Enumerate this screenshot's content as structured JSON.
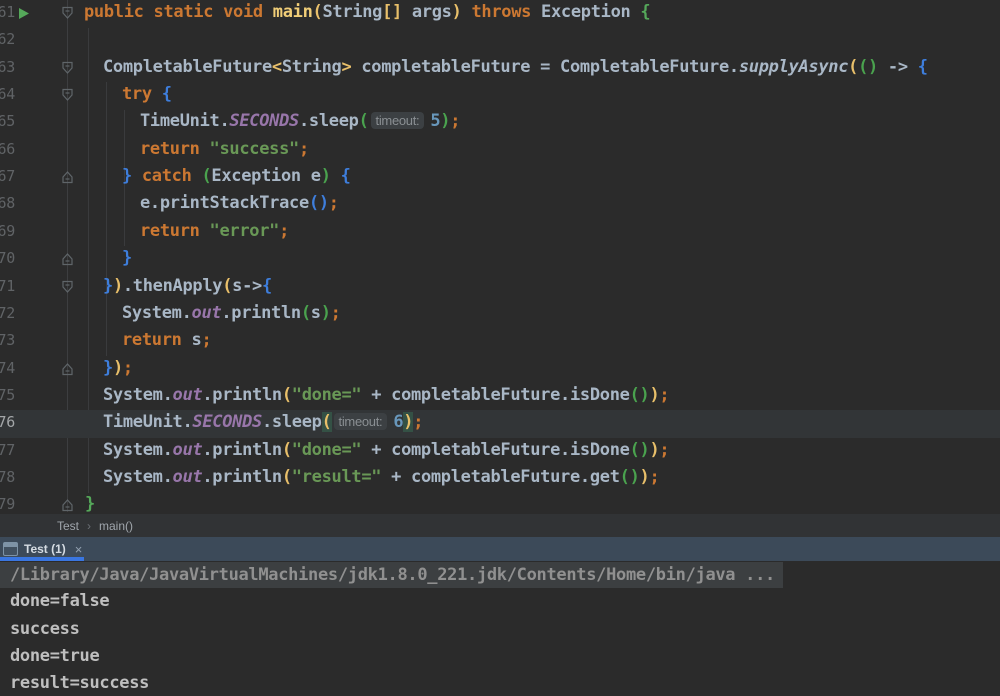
{
  "editor": {
    "lines": [
      {
        "num": "61",
        "indent": 84,
        "fold": "down",
        "run": true,
        "current": false,
        "tokens": [
          [
            "kw",
            "public static void "
          ],
          [
            "def",
            "main"
          ],
          [
            "y",
            "("
          ],
          [
            "txt",
            "String"
          ],
          [
            "y",
            "[]"
          ],
          [
            "txt",
            " args"
          ],
          [
            "y",
            ")"
          ],
          [
            "kw",
            " throws "
          ],
          [
            "txt",
            "Exception "
          ],
          [
            "mg",
            "{"
          ]
        ]
      },
      {
        "num": "62",
        "indent": 84,
        "fold": null,
        "run": false,
        "current": false,
        "tokens": []
      },
      {
        "num": "63",
        "indent": 103,
        "fold": "down",
        "run": false,
        "current": false,
        "tokens": [
          [
            "txt",
            "CompletableFuture"
          ],
          [
            "y",
            "<"
          ],
          [
            "txt",
            "String"
          ],
          [
            "y",
            ">"
          ],
          [
            "txt",
            " completableFuture = CompletableFuture."
          ],
          [
            "it",
            "supplyAsync"
          ],
          [
            "y",
            "("
          ],
          [
            "g",
            "()"
          ],
          [
            "txt",
            " -> "
          ],
          [
            "b",
            "{"
          ]
        ]
      },
      {
        "num": "64",
        "indent": 122,
        "fold": "down",
        "run": false,
        "current": false,
        "tokens": [
          [
            "kw",
            "try "
          ],
          [
            "b",
            "{"
          ]
        ]
      },
      {
        "num": "65",
        "indent": 140,
        "fold": null,
        "run": false,
        "current": false,
        "tokens": [
          [
            "txt",
            "TimeUnit."
          ],
          [
            "pu",
            "SECONDS"
          ],
          [
            "txt",
            ".sleep"
          ],
          [
            "g",
            "("
          ],
          [
            "hint",
            "timeout:"
          ],
          [
            "num",
            "5"
          ],
          [
            "g",
            ")"
          ],
          [
            "semi",
            ";"
          ]
        ]
      },
      {
        "num": "66",
        "indent": 140,
        "fold": null,
        "run": false,
        "current": false,
        "tokens": [
          [
            "kw",
            "return "
          ],
          [
            "str",
            "\"success\""
          ],
          [
            "semi",
            ";"
          ]
        ]
      },
      {
        "num": "67",
        "indent": 122,
        "fold": "up",
        "run": false,
        "current": false,
        "tokens": [
          [
            "b",
            "} "
          ],
          [
            "kw",
            "catch "
          ],
          [
            "g",
            "("
          ],
          [
            "txt",
            "Exception e"
          ],
          [
            "g",
            ")"
          ],
          [
            "txt",
            " "
          ],
          [
            "b",
            "{"
          ]
        ]
      },
      {
        "num": "68",
        "indent": 140,
        "fold": null,
        "run": false,
        "current": false,
        "tokens": [
          [
            "txt",
            "e.printStackTrace"
          ],
          [
            "b",
            "()"
          ],
          [
            "semi",
            ";"
          ]
        ]
      },
      {
        "num": "69",
        "indent": 140,
        "fold": null,
        "run": false,
        "current": false,
        "tokens": [
          [
            "kw",
            "return "
          ],
          [
            "str",
            "\"error\""
          ],
          [
            "semi",
            ";"
          ]
        ]
      },
      {
        "num": "70",
        "indent": 122,
        "fold": "up",
        "run": false,
        "current": false,
        "tokens": [
          [
            "b",
            "}"
          ]
        ]
      },
      {
        "num": "71",
        "indent": 103,
        "fold": "down",
        "run": false,
        "current": false,
        "tokens": [
          [
            "b",
            "}"
          ],
          [
            "y",
            ")"
          ],
          [
            "txt",
            ".thenApply"
          ],
          [
            "y",
            "("
          ],
          [
            "txt",
            "s->"
          ],
          [
            "b",
            "{"
          ]
        ]
      },
      {
        "num": "72",
        "indent": 122,
        "fold": null,
        "run": false,
        "current": false,
        "tokens": [
          [
            "txt",
            "System."
          ],
          [
            "pu",
            "out"
          ],
          [
            "txt",
            ".println"
          ],
          [
            "g",
            "("
          ],
          [
            "txt",
            "s"
          ],
          [
            "g",
            ")"
          ],
          [
            "semi",
            ";"
          ]
        ]
      },
      {
        "num": "73",
        "indent": 122,
        "fold": null,
        "run": false,
        "current": false,
        "tokens": [
          [
            "kw",
            "return "
          ],
          [
            "txt",
            "s"
          ],
          [
            "semi",
            ";"
          ]
        ]
      },
      {
        "num": "74",
        "indent": 103,
        "fold": "up",
        "run": false,
        "current": false,
        "tokens": [
          [
            "b",
            "}"
          ],
          [
            "y",
            ")"
          ],
          [
            "semi",
            ";"
          ]
        ]
      },
      {
        "num": "75",
        "indent": 103,
        "fold": null,
        "run": false,
        "current": false,
        "tokens": [
          [
            "txt",
            "System."
          ],
          [
            "pu",
            "out"
          ],
          [
            "txt",
            ".println"
          ],
          [
            "y",
            "("
          ],
          [
            "str",
            "\"done=\""
          ],
          [
            "txt",
            " + completableFuture.isDone"
          ],
          [
            "g",
            "()"
          ],
          [
            "y",
            ")"
          ],
          [
            "semi",
            ";"
          ]
        ]
      },
      {
        "num": "76",
        "indent": 103,
        "fold": null,
        "run": false,
        "current": true,
        "tokens": [
          [
            "txt",
            "TimeUnit."
          ],
          [
            "pu",
            "SECONDS"
          ],
          [
            "txt",
            ".sleep"
          ],
          [
            "yh",
            "("
          ],
          [
            "hint",
            "timeout:"
          ],
          [
            "num",
            "6"
          ],
          [
            "yh",
            ")"
          ],
          [
            "semi",
            ";"
          ]
        ]
      },
      {
        "num": "77",
        "indent": 103,
        "fold": null,
        "run": false,
        "current": false,
        "tokens": [
          [
            "txt",
            "System."
          ],
          [
            "pu",
            "out"
          ],
          [
            "txt",
            ".println"
          ],
          [
            "y",
            "("
          ],
          [
            "str",
            "\"done=\""
          ],
          [
            "txt",
            " + completableFuture.isDone"
          ],
          [
            "g",
            "()"
          ],
          [
            "y",
            ")"
          ],
          [
            "semi",
            ";"
          ]
        ]
      },
      {
        "num": "78",
        "indent": 103,
        "fold": null,
        "run": false,
        "current": false,
        "tokens": [
          [
            "txt",
            "System."
          ],
          [
            "pu",
            "out"
          ],
          [
            "txt",
            ".println"
          ],
          [
            "y",
            "("
          ],
          [
            "str",
            "\"result=\""
          ],
          [
            "txt",
            " + completableFuture.get"
          ],
          [
            "g",
            "()"
          ],
          [
            "y",
            ")"
          ],
          [
            "semi",
            ";"
          ]
        ]
      },
      {
        "num": "79",
        "indent": 85,
        "fold": "up",
        "run": false,
        "current": false,
        "tokens": [
          [
            "mg",
            "}"
          ]
        ]
      }
    ]
  },
  "breadcrumb": {
    "separator": "›",
    "items": [
      "Test",
      "main()"
    ]
  },
  "toolwindow": {
    "tab_label": "Test (1)",
    "close_label": "×"
  },
  "console": {
    "lines": [
      {
        "style": "path",
        "text": "/Library/Java/JavaVirtualMachines/jdk1.8.0_221.jdk/Contents/Home/bin/java ..."
      },
      {
        "style": "out",
        "text": "done=false"
      },
      {
        "style": "out",
        "text": "success"
      },
      {
        "style": "out",
        "text": "done=true"
      },
      {
        "style": "out",
        "text": "result=success"
      }
    ]
  },
  "colors": {
    "editor_bg": "#2B2B2B",
    "current_line_bg": "#323537",
    "keyword_orange": "#CC7832",
    "default_text": "#A9B7C6",
    "string_green": "#699856",
    "number_blue": "#6897BB",
    "field_purple": "#9876AA",
    "bracket_yellow": "#E8BF6A",
    "bracket_green": "#4AA24E",
    "bracket_blue": "#3E7EDC",
    "method_brace_green": "#55A85A",
    "line_number_gray": "#606366",
    "matched_paren_bg": "#345145",
    "breadcrumb_bg": "#313335",
    "toolwindow_header_bg": "#3C4A59",
    "active_tab_accent": "#3A76E0",
    "console_path_band": "#3C3F41",
    "run_arrow_green": "#55A85A"
  }
}
